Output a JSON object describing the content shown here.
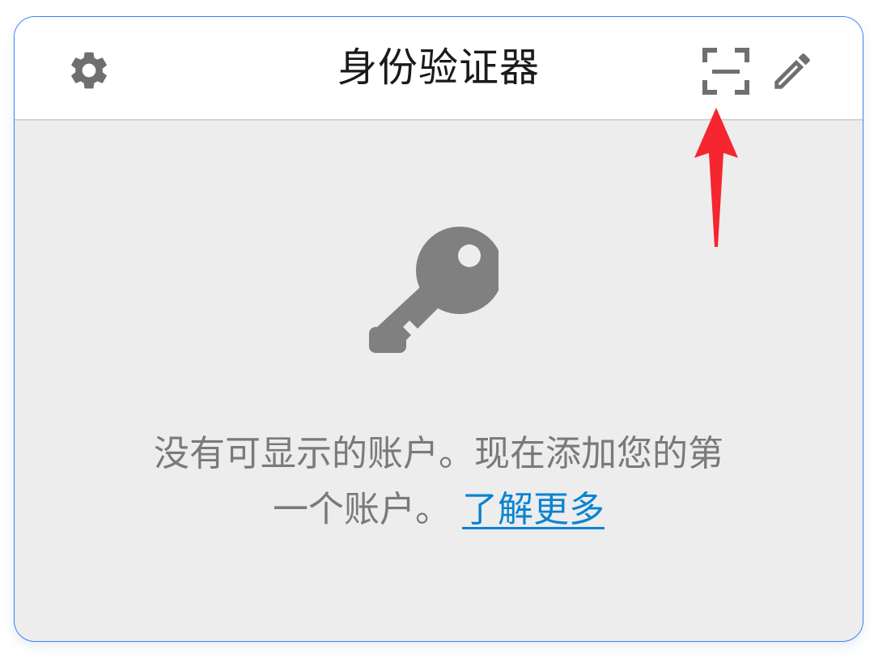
{
  "header": {
    "title": "身份验证器",
    "settings_icon": "gear-icon",
    "scan_icon": "scan-qr-icon",
    "edit_icon": "pencil-icon"
  },
  "empty_state": {
    "icon": "key-icon",
    "message_line1": "没有可显示的账户。现在添加您的第",
    "message_line2": "一个账户。",
    "learn_more_link": "了解更多"
  },
  "colors": {
    "accent_link": "#0a84d1",
    "annotation_arrow": "#f5262f",
    "border": "#3b82f6",
    "icon_gray": "#6f6f6f"
  }
}
